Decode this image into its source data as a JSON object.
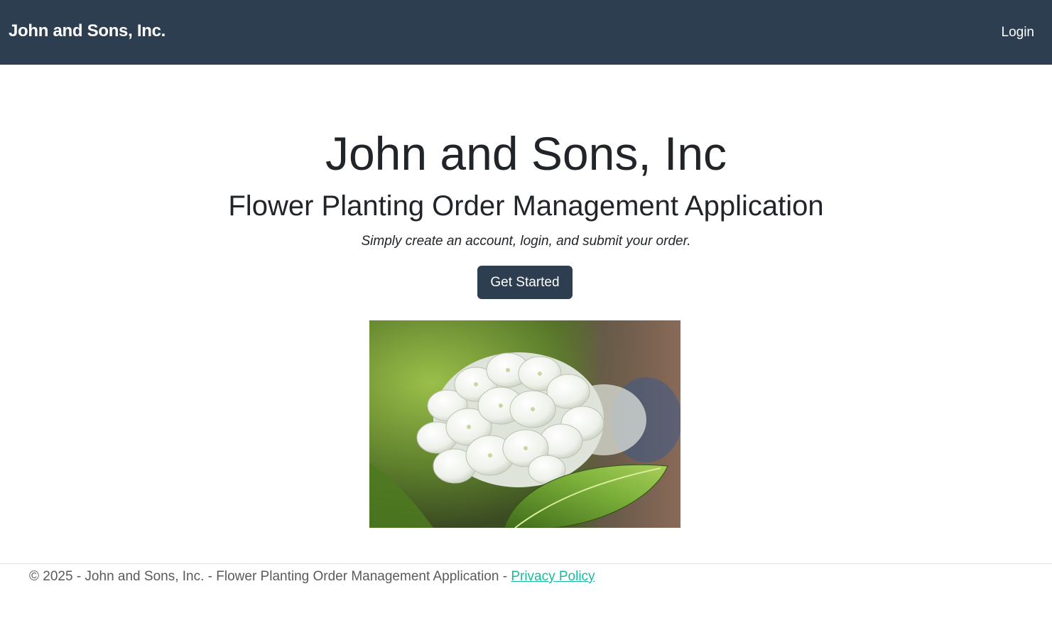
{
  "navbar": {
    "brand": "John and Sons, Inc.",
    "login_label": "Login"
  },
  "hero": {
    "title": "John and Sons, Inc",
    "subtitle": "Flower Planting Order Management Application",
    "tagline": "Simply create an account, login, and submit your order.",
    "cta_label": "Get Started",
    "image_icon": "white-hydrangea-photo"
  },
  "footer": {
    "text": "© 2025 - John and Sons, Inc. - Flower Planting Order Management Application - ",
    "privacy_link": "Privacy Policy"
  },
  "colors": {
    "navbar_bg": "#2c3e50",
    "button_bg": "#2c3e50",
    "link": "#18bc9c",
    "text": "#212529"
  }
}
